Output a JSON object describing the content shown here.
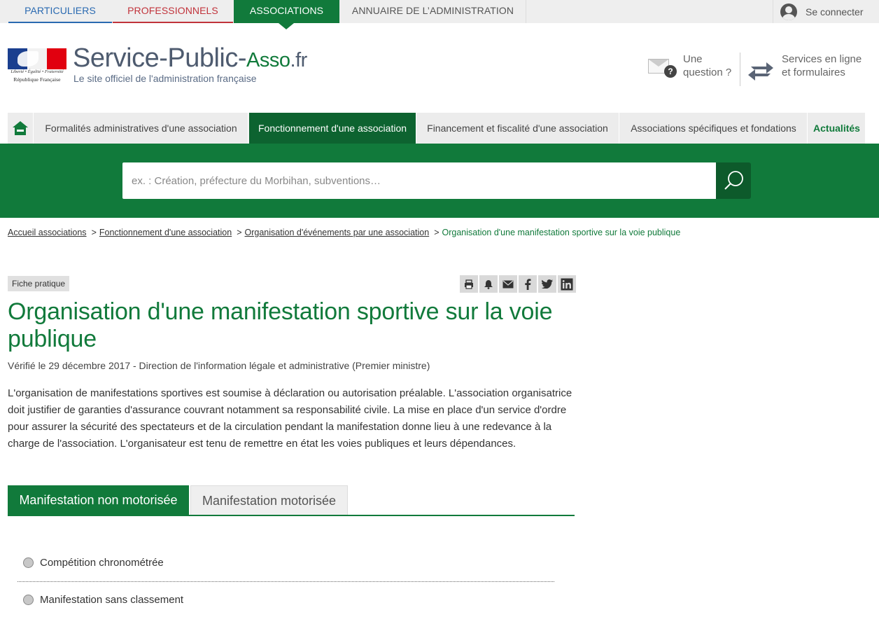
{
  "topbar": {
    "tabs": [
      "PARTICULIERS",
      "PROFESSIONNELS",
      "ASSOCIATIONS",
      "ANNUAIRE DE L’ADMINISTRATION"
    ],
    "connect": "Se connecter"
  },
  "header": {
    "motto": "Liberté • Égalité • Fraternité",
    "republic": "République Française",
    "title_main": "Service-Public-",
    "title_asso": "Asso",
    "title_fr": ".fr",
    "subtitle": "Le site officiel de l'administration française",
    "question": [
      "Une",
      "question ?"
    ],
    "services": [
      "Services en ligne",
      "et formulaires"
    ]
  },
  "nav": {
    "items": [
      "Formalités administratives d'une association",
      "Fonctionnement d'une association",
      "Financement et fiscalité d'une association",
      "Associations spécifiques et fondations",
      "Actualités"
    ]
  },
  "search": {
    "placeholder": "ex. : Création, préfecture du Morbihan, subventions…"
  },
  "breadcrumb": {
    "items": [
      "Accueil associations",
      "Fonctionnement d'une association",
      "Organisation d'événements par une association"
    ],
    "current": "Organisation d'une manifestation sportive sur la voie publique"
  },
  "article": {
    "badge": "Fiche pratique",
    "title": "Organisation d'une manifestation sportive sur la voie publique",
    "verified": "Vérifié le 29 décembre 2017 - Direction de l'information légale et administrative (Premier ministre)",
    "intro": "L'organisation de manifestations sportives est soumise à déclaration ou autorisation préalable. L'association organisatrice doit justifier de garanties d'assurance couvrant notamment sa responsabilité civile. La mise en place d'un service d'ordre pour assurer la sécurité des spectateurs et de la circulation pendant la manifestation donne lieu à une redevance à la charge de l'association. L'organisateur est tenu de remettre en état les voies publiques et leurs dépendances.",
    "tabs": [
      "Manifestation non motorisée",
      "Manifestation motorisée"
    ],
    "options": [
      "Compétition chronométrée",
      "Manifestation sans classement"
    ]
  },
  "colors": {
    "green": "#117a3b",
    "dark_green": "#0d6330",
    "blue": "#2a6ab1",
    "red": "#c1333b"
  }
}
